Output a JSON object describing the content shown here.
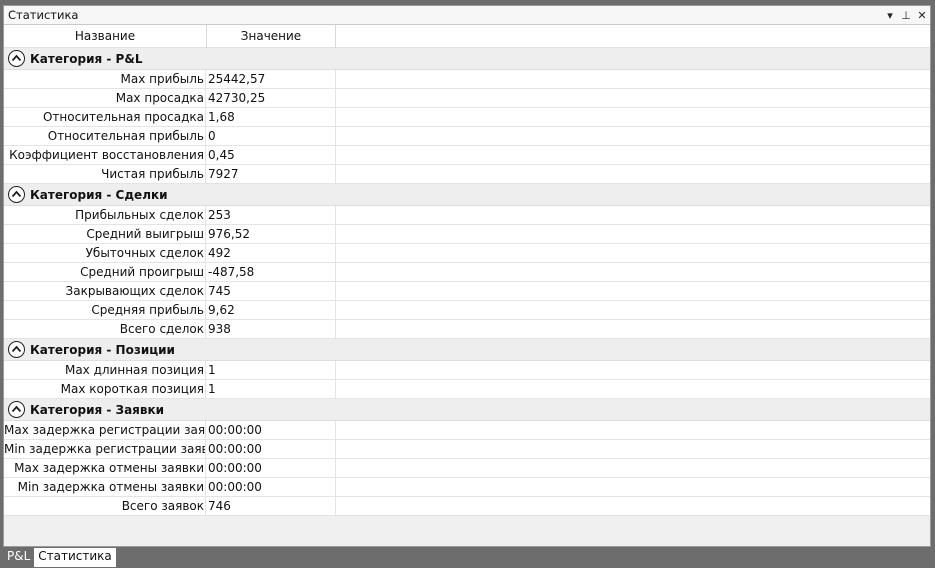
{
  "window": {
    "title": "Статистика",
    "controls": {
      "dropdown": "▾",
      "pin": "⊥",
      "close": "✕"
    }
  },
  "columns": {
    "name": "Название",
    "value": "Значение"
  },
  "categories": [
    {
      "label": "Категория - P&L",
      "rows": [
        {
          "name": "Max прибыль",
          "value": "25442,57"
        },
        {
          "name": "Max просадка",
          "value": "42730,25"
        },
        {
          "name": "Относительная просадка",
          "value": "1,68"
        },
        {
          "name": "Относительная прибыль",
          "value": "0"
        },
        {
          "name": "Коэффициент восстановления",
          "value": "0,45"
        },
        {
          "name": "Чистая прибыль",
          "value": "7927"
        }
      ]
    },
    {
      "label": "Категория - Сделки",
      "rows": [
        {
          "name": "Прибыльных сделок",
          "value": "253"
        },
        {
          "name": "Средний выигрыш",
          "value": "976,52"
        },
        {
          "name": "Убыточных сделок",
          "value": "492"
        },
        {
          "name": "Средний проигрыш",
          "value": "-487,58"
        },
        {
          "name": "Закрывающих сделок",
          "value": "745"
        },
        {
          "name": "Средняя прибыль",
          "value": "9,62"
        },
        {
          "name": "Всего сделок",
          "value": "938"
        }
      ]
    },
    {
      "label": "Категория - Позиции",
      "rows": [
        {
          "name": "Max длинная позиция",
          "value": "1"
        },
        {
          "name": "Max короткая позиция",
          "value": "1"
        }
      ]
    },
    {
      "label": "Категория - Заявки",
      "rows": [
        {
          "name": "Max задержка регистрации заявки",
          "value": "00:00:00"
        },
        {
          "name": "Min задержка регистрации заявки",
          "value": "00:00:00"
        },
        {
          "name": "Max задержка отмены заявки",
          "value": "00:00:00"
        },
        {
          "name": "Min задержка отмены заявки",
          "value": "00:00:00"
        },
        {
          "name": "Всего заявок",
          "value": "746"
        }
      ]
    }
  ],
  "tabs": [
    {
      "label": "P&L",
      "active": false
    },
    {
      "label": "Статистика",
      "active": true
    }
  ]
}
